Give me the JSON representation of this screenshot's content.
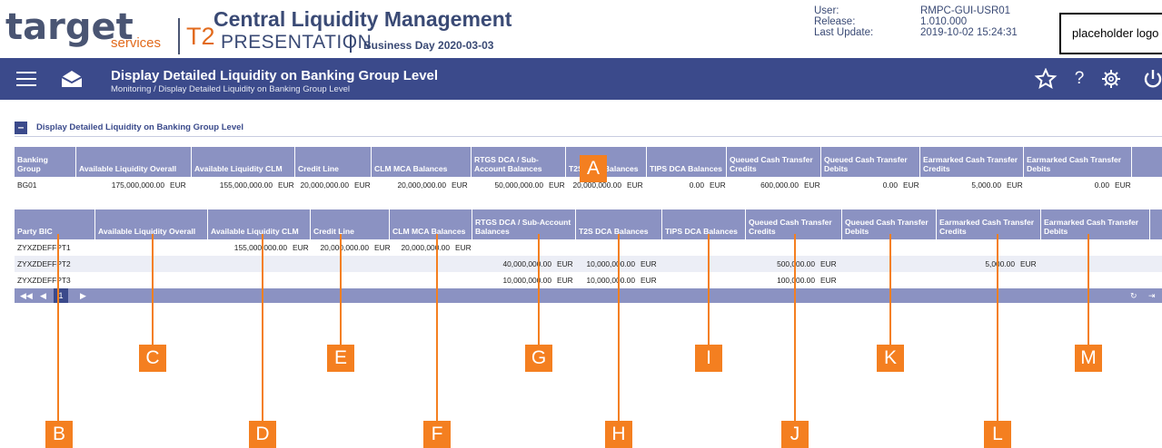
{
  "header": {
    "brand": "target",
    "brand_sub": "services",
    "module": "T2",
    "app_title": "Central Liquidity Management",
    "environment": "PRESENTATION",
    "business_day": "Business Day 2020-03-03",
    "user_label": "User:",
    "release_label": "Release:",
    "update_label": "Last Update:",
    "user_value": "RMPC-GUI-USR01",
    "release_value": "1.010.000",
    "update_value": "2019-10-02 15:24:31",
    "logo_placeholder": "placeholder logo"
  },
  "nav": {
    "title": "Display Detailed Liquidity on Banking Group Level",
    "breadcrumb": "Monitoring / Display Detailed Liquidity on Banking Group Level",
    "icons": [
      "menu-icon",
      "mail-icon",
      "star-icon",
      "help-icon",
      "settings-icon",
      "power-icon"
    ],
    "help_glyph": "?"
  },
  "section": {
    "toggle": "–",
    "title": "Display Detailed Liquidity on Banking Group Level"
  },
  "group_table": {
    "headers": [
      "Banking Group",
      "Available Liquidity Overall",
      "Available Liquidity CLM",
      "Credit Line",
      "CLM MCA Balances",
      "RTGS DCA / Sub-Account Balances",
      "T2S DCA Balances",
      "TIPS DCA Balances",
      "Queued Cash Transfer Credits",
      "Queued Cash Transfer Debits",
      "Earmarked Cash Transfer Credits",
      "Earmarked Cash Transfer Debits"
    ],
    "row": [
      "BG01",
      "175,000,000.00",
      "155,000,000.00",
      "20,000,000.00",
      "20,000,000.00",
      "50,000,000.00",
      "20,000,000.00",
      "0.00",
      "600,000.00",
      "0.00",
      "5,000.00",
      "0.00"
    ],
    "currency": "EUR"
  },
  "party_table": {
    "headers": [
      "Party BIC",
      "Available Liquidity Overall",
      "Available Liquidity CLM",
      "Credit Line",
      "CLM MCA Balances",
      "RTGS DCA / Sub-Account Balances",
      "T2S DCA Balances",
      "TIPS DCA Balances",
      "Queued Cash Transfer Credits",
      "Queued Cash Transfer Debits",
      "Earmarked Cash Transfer Credits",
      "Earmarked Cash Transfer Debits"
    ],
    "rows": [
      [
        "ZYXZDEFFPT1",
        "",
        "155,000,000.00",
        "20,000,000.00",
        "20,000,000.00",
        "",
        "",
        "",
        "",
        "",
        "",
        ""
      ],
      [
        "ZYXZDEFFPT2",
        "",
        "",
        "",
        "",
        "40,000,000.00",
        "10,000,000.00",
        "",
        "500,000.00",
        "",
        "5,000.00",
        ""
      ],
      [
        "ZYXZDEFFPT3",
        "",
        "",
        "",
        "",
        "10,000,000.00",
        "10,000,000.00",
        "",
        "100,000.00",
        "",
        "",
        ""
      ]
    ],
    "currency": "EUR",
    "pager": {
      "current_page": "1"
    }
  },
  "annotations": {
    "labels": [
      "A",
      "B",
      "C",
      "D",
      "E",
      "F",
      "G",
      "H",
      "I",
      "J",
      "K",
      "L",
      "M"
    ],
    "color": "#f47f20"
  },
  "colors": {
    "navbar": "#3b4a8b",
    "table_header": "#8b92c2",
    "brand_orange": "#e26a1c",
    "brand_navy": "#3a4a75"
  }
}
